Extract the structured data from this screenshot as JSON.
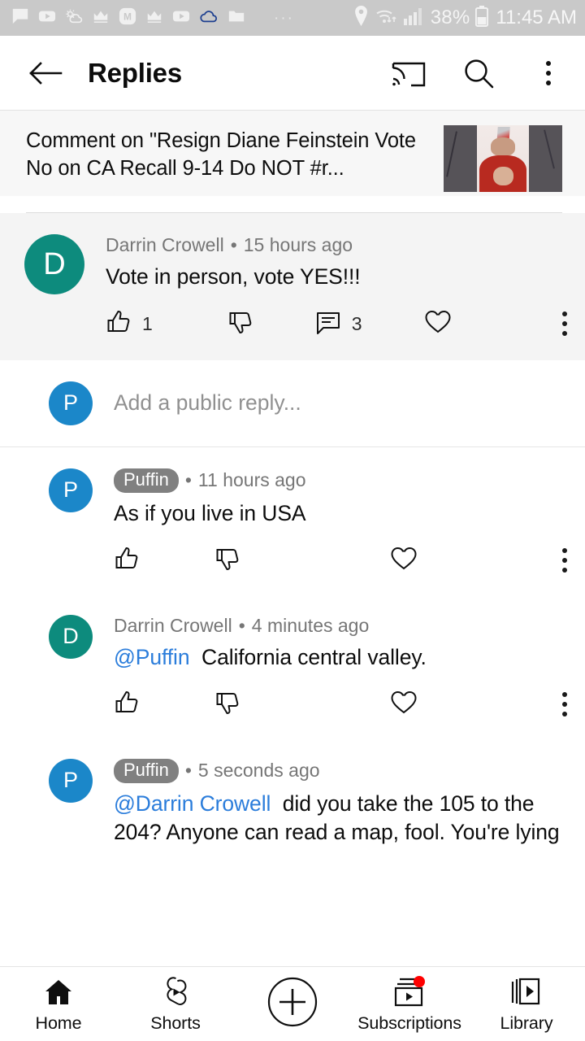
{
  "statusbar": {
    "icons": [
      "chat-bubble-icon",
      "youtube-icon",
      "weather-icon",
      "crown-icon",
      "m-app-icon",
      "crown-icon",
      "youtube-icon",
      "cloud-icon",
      "folder-icon"
    ],
    "overflow": "···",
    "location_icon": "location-pin-icon",
    "wifi_icon": "wifi-icon",
    "signal_icon": "signal-bars-icon",
    "battery_percent": "38%",
    "battery_icon": "battery-icon",
    "time": "11:45 AM"
  },
  "header": {
    "back_icon": "back-arrow-icon",
    "title": "Replies",
    "cast_icon": "cast-icon",
    "search_icon": "search-icon",
    "overflow_icon": "more-vertical-icon"
  },
  "video_banner": {
    "title": "Comment on \"Resign Diane Feinstein Vote No on CA Recall 9-14 Do NOT  #r...",
    "thumbnail": "video-thumbnail"
  },
  "parent_comment": {
    "avatar_letter": "D",
    "avatar_color": "#0d8b7d",
    "author": "Darrin Crowell",
    "separator": "•",
    "time": "15 hours ago",
    "text": "Vote in person, vote YES!!!",
    "like_count": "1",
    "reply_count": "3",
    "like_icon": "thumbs-up-icon",
    "dislike_icon": "thumbs-down-icon",
    "reply_icon": "comment-icon",
    "heart_icon": "heart-icon",
    "overflow_icon": "more-vertical-icon"
  },
  "reply_composer": {
    "avatar_letter": "P",
    "avatar_color": "#1b87c9",
    "placeholder": "Add a public reply..."
  },
  "replies": [
    {
      "avatar_letter": "P",
      "avatar_color": "#1b87c9",
      "author": "Puffin",
      "author_is_badge": true,
      "separator": "•",
      "time": "11 hours ago",
      "mention": "",
      "text": "As if you live in USA",
      "like_icon": "thumbs-up-icon",
      "dislike_icon": "thumbs-down-icon",
      "heart_icon": "heart-icon",
      "overflow_icon": "more-vertical-icon"
    },
    {
      "avatar_letter": "D",
      "avatar_color": "#0d8b7d",
      "author": "Darrin Crowell",
      "author_is_badge": false,
      "separator": "•",
      "time": "4 minutes ago",
      "mention": "@Puffin",
      "text": "California central valley.",
      "like_icon": "thumbs-up-icon",
      "dislike_icon": "thumbs-down-icon",
      "heart_icon": "heart-icon",
      "overflow_icon": "more-vertical-icon"
    },
    {
      "avatar_letter": "P",
      "avatar_color": "#1b87c9",
      "author": "Puffin",
      "author_is_badge": true,
      "separator": "•",
      "time": "5 seconds ago",
      "mention": "@Darrin Crowell",
      "text": "did you take the 105 to the 204? Anyone can read a map, fool. You're lying",
      "like_icon": "thumbs-up-icon",
      "dislike_icon": "thumbs-down-icon",
      "heart_icon": "heart-icon",
      "overflow_icon": "more-vertical-icon"
    }
  ],
  "bottom_nav": {
    "items": [
      {
        "label": "Home",
        "icon": "home-icon",
        "active": true,
        "badge": false
      },
      {
        "label": "Shorts",
        "icon": "shorts-icon",
        "active": false,
        "badge": false
      },
      {
        "label": "",
        "icon": "create-plus-icon",
        "active": false,
        "badge": false
      },
      {
        "label": "Subscriptions",
        "icon": "subscriptions-icon",
        "active": false,
        "badge": true
      },
      {
        "label": "Library",
        "icon": "library-icon",
        "active": false,
        "badge": false
      }
    ]
  },
  "colors": {
    "accent_blue": "#2b7ddb",
    "badge_red": "#ff0000",
    "avatar_teal": "#0d8b7d",
    "avatar_blue": "#1b87c9",
    "author_badge_gray": "#808080"
  }
}
